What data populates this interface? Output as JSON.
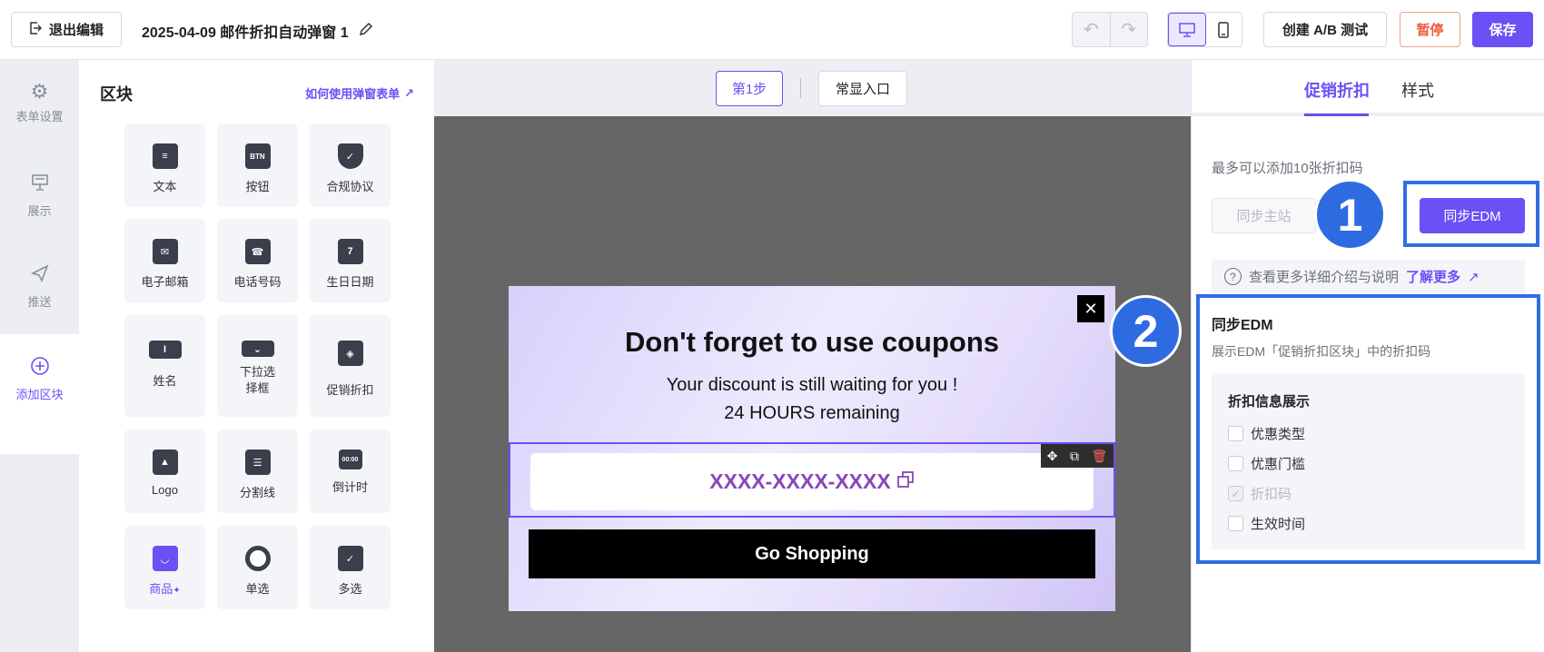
{
  "header": {
    "exit_label": "退出编辑",
    "doc_title": "2025-04-09 邮件折扣自动弹窗 1",
    "ab_test_label": "创建 A/B 测试",
    "pause_label": "暂停",
    "save_label": "保存"
  },
  "rail": {
    "items": [
      {
        "label": "表单设置",
        "icon": "gear-icon"
      },
      {
        "label": "展示",
        "icon": "display-icon"
      },
      {
        "label": "推送",
        "icon": "send-icon"
      },
      {
        "label": "添加区块",
        "icon": "plus-circle-icon",
        "active": true
      }
    ]
  },
  "blocks": {
    "title": "区块",
    "help_link": "如何使用弹窗表单",
    "tiles": [
      {
        "label": "文本",
        "icon": "text-icon"
      },
      {
        "label": "按钮",
        "icon": "button-icon",
        "glyph": "BTN"
      },
      {
        "label": "合规协议",
        "icon": "shield-icon"
      },
      {
        "label": "电子邮箱",
        "icon": "mail-icon"
      },
      {
        "label": "电话号码",
        "icon": "phone-icon"
      },
      {
        "label": "生日日期",
        "icon": "calendar-icon",
        "glyph": "7"
      },
      {
        "label": "姓名",
        "icon": "name-field-icon",
        "glyph": "I"
      },
      {
        "label": "下拉选择框",
        "icon": "dropdown-icon"
      },
      {
        "label": "促销折扣",
        "icon": "tag-icon"
      },
      {
        "label": "Logo",
        "icon": "image-icon"
      },
      {
        "label": "分割线",
        "icon": "divider-icon"
      },
      {
        "label": "倒计时",
        "icon": "countdown-icon",
        "glyph": "00:00"
      },
      {
        "label": "商品",
        "icon": "bag-icon",
        "active": true
      },
      {
        "label": "单选",
        "icon": "radio-icon"
      },
      {
        "label": "多选",
        "icon": "checkbox-icon"
      }
    ]
  },
  "canvas": {
    "step_label": "第1步",
    "entry_label": "常显入口",
    "popup": {
      "heading": "Don't forget to use coupons",
      "sub1": "Your discount is still waiting for you !",
      "sub2": "24 HOURS remaining",
      "coupon_code": "XXXX-XXXX-XXXX",
      "cta": "Go Shopping"
    }
  },
  "right_panel": {
    "tabs": [
      "促销折扣",
      "样式"
    ],
    "active_tab": "促销折扣",
    "hint": "最多可以添加10张折扣码",
    "sync_main_label": "同步主站",
    "sync_edm_label": "同步EDM",
    "more_text": "查看更多详细介绍与说明",
    "more_link": "了解更多",
    "section_title": "同步EDM",
    "section_desc": "展示EDM「促销折扣区块」中的折扣码",
    "options_title": "折扣信息展示",
    "options": [
      {
        "label": "优惠类型",
        "checked": false,
        "disabled": false
      },
      {
        "label": "优惠门槛",
        "checked": false,
        "disabled": false
      },
      {
        "label": "折扣码",
        "checked": true,
        "disabled": true
      },
      {
        "label": "生效时间",
        "checked": false,
        "disabled": false
      }
    ]
  },
  "annotations": {
    "badge1": "1",
    "badge2": "2",
    "highlight_color": "#2f6de3"
  },
  "colors": {
    "accent": "#6c4ff5",
    "pause": "#f05a3a",
    "canvas_bg": "#666666"
  }
}
